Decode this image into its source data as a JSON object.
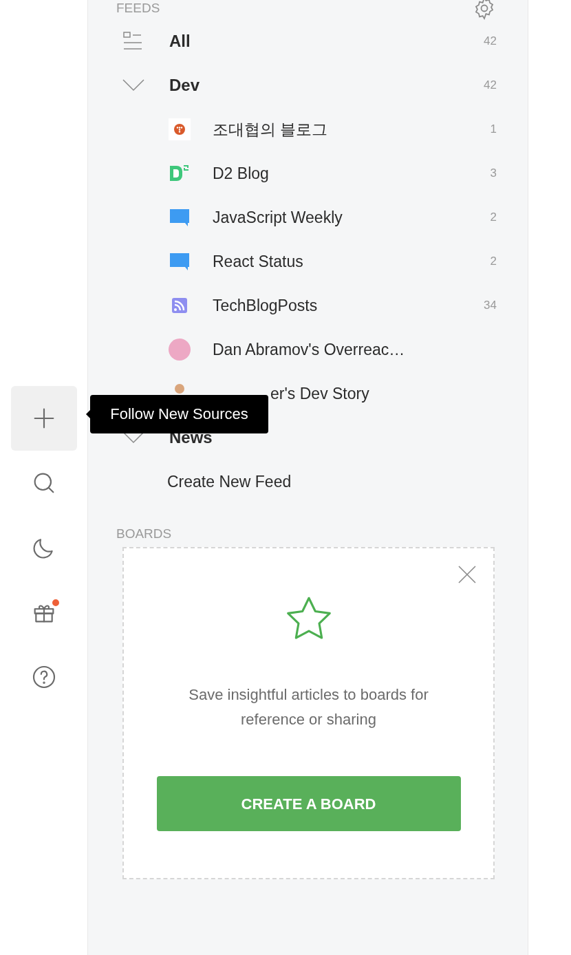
{
  "sidebar": {
    "buttons": [
      {
        "kind": "plus",
        "selected": true,
        "badge": false
      },
      {
        "kind": "search",
        "selected": false,
        "badge": false
      },
      {
        "kind": "moon",
        "selected": false,
        "badge": false
      },
      {
        "kind": "gift",
        "selected": false,
        "badge": true
      },
      {
        "kind": "help",
        "selected": false,
        "badge": false
      }
    ]
  },
  "tooltip": {
    "text": "Follow New Sources"
  },
  "feeds": {
    "title": "FEEDS",
    "items": [
      {
        "kind": "all",
        "label": "All",
        "count": "42"
      },
      {
        "kind": "folder",
        "label": "Dev",
        "count": "42",
        "children": [
          {
            "kind": "orange-dot",
            "label": "조대협의 블로그",
            "count": "1"
          },
          {
            "kind": "d2",
            "label": "D2 Blog",
            "count": "3"
          },
          {
            "kind": "chat",
            "label": "JavaScript Weekly",
            "count": "2"
          },
          {
            "kind": "chat",
            "label": "React Status",
            "count": "2"
          },
          {
            "kind": "rss",
            "label": "TechBlogPosts",
            "count": "34"
          },
          {
            "kind": "pink-circle",
            "label": "Dan Abramov's Overreac…"
          },
          {
            "kind": "avatar",
            "label": "er's Dev Story"
          }
        ]
      },
      {
        "kind": "folder",
        "label": "News"
      }
    ],
    "create": "Create New Feed"
  },
  "boards": {
    "title": "BOARDS",
    "card": {
      "text": "Save insightful articles to boards for reference or sharing",
      "button": "CREATE A BOARD"
    }
  }
}
